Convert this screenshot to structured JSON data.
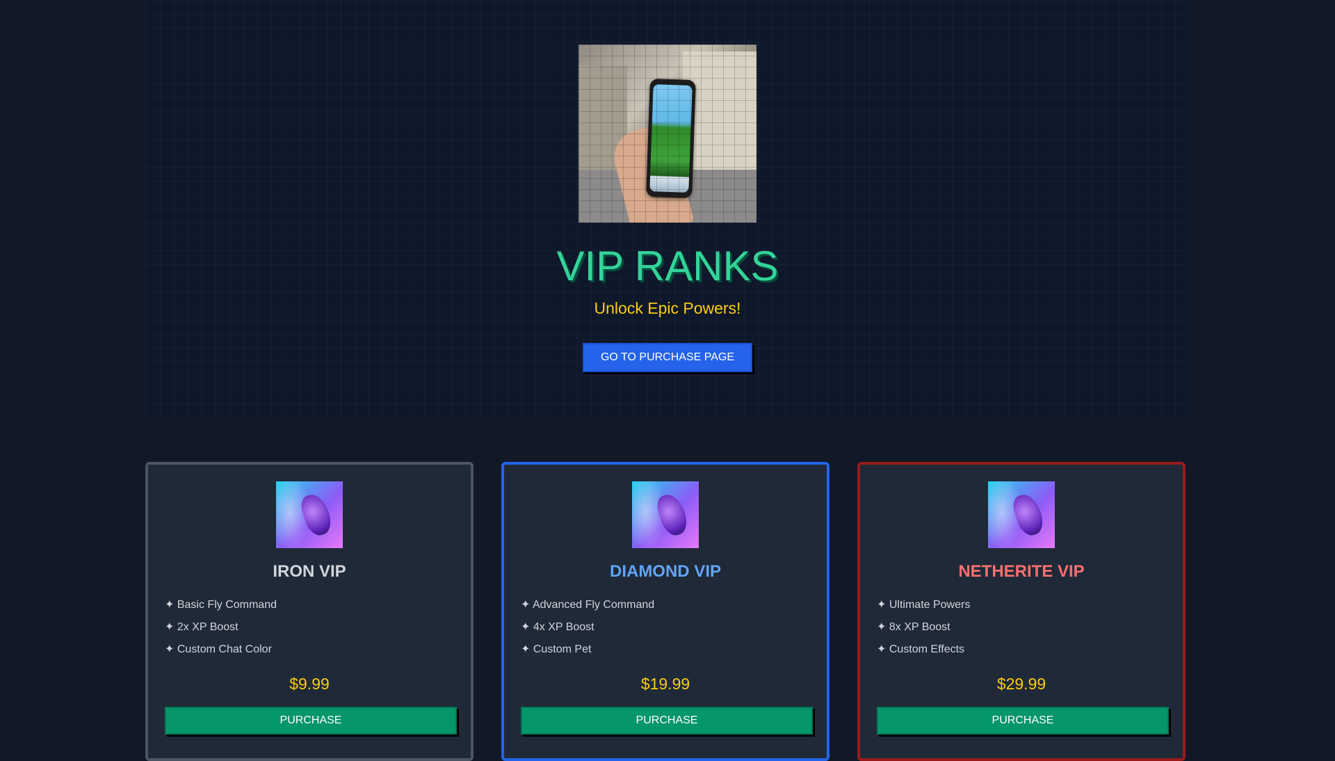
{
  "hero": {
    "image_alt": "hand holding phone with game",
    "title": "VIP RANKS",
    "subtitle": "Unlock Epic Powers!",
    "cta_label": "GO TO PURCHASE PAGE"
  },
  "colors": {
    "background": "#111827",
    "title": "#34d399",
    "subtitle": "#facc15",
    "cta": "#2563eb",
    "purchase_button": "#059669",
    "iron": "#d1d5db",
    "diamond": "#60a5fa",
    "netherite": "#f87171"
  },
  "ranks": [
    {
      "name": "IRON VIP",
      "name_color": "#d1d5db",
      "features": [
        "✦ Basic Fly Command",
        "✦ 2x XP Boost",
        "✦ Custom Chat Color"
      ],
      "price": "$9.99",
      "button_label": "PURCHASE",
      "icon": "game-controller-icon"
    },
    {
      "name": "DIAMOND VIP",
      "name_color": "#60a5fa",
      "features": [
        "✦ Advanced Fly Command",
        "✦ 4x XP Boost",
        "✦ Custom Pet"
      ],
      "price": "$19.99",
      "button_label": "PURCHASE",
      "icon": "game-controller-icon"
    },
    {
      "name": "NETHERITE VIP",
      "name_color": "#f87171",
      "features": [
        "✦ Ultimate Powers",
        "✦ 8x XP Boost",
        "✦ Custom Effects"
      ],
      "price": "$29.99",
      "button_label": "PURCHASE",
      "icon": "game-controller-icon"
    }
  ]
}
